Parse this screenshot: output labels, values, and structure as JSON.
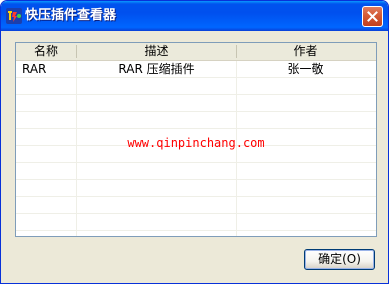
{
  "window": {
    "title": "快压插件查看器"
  },
  "list": {
    "columns": [
      "名称",
      "描述",
      "作者"
    ],
    "rows": [
      {
        "name": "RAR",
        "description": "RAR 压缩插件",
        "author": "张一敬"
      }
    ]
  },
  "watermark": "www.qinpinchang.com",
  "buttons": {
    "ok_label": "确定(O)"
  },
  "colors": {
    "titlebar": "#0054e3",
    "close_button": "#d45a35",
    "watermark": "#ff0000",
    "window_bg": "#ece9d8"
  },
  "icons": {
    "app": "app-logo-icon",
    "close": "close-icon"
  }
}
